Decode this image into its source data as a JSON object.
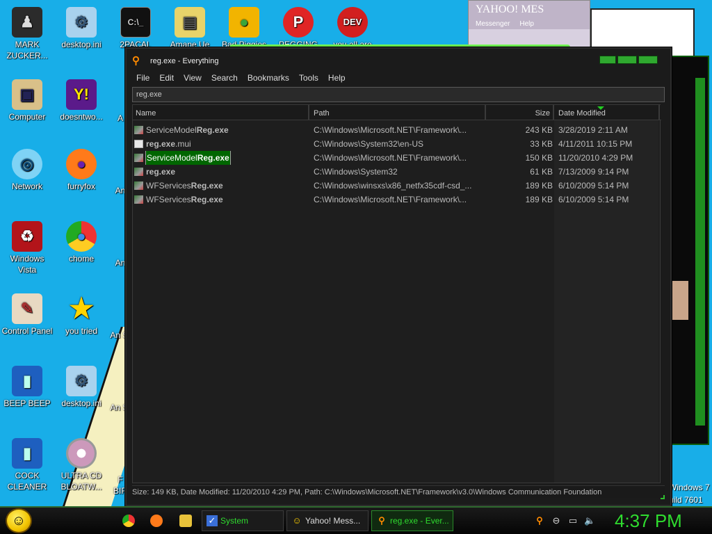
{
  "window": {
    "title": "reg.exe - Everything",
    "menu": [
      "File",
      "Edit",
      "View",
      "Search",
      "Bookmarks",
      "Tools",
      "Help"
    ],
    "search_value": "reg.exe",
    "columns": {
      "name": "Name",
      "path": "Path",
      "size": "Size",
      "date": "Date Modified"
    },
    "files": [
      {
        "pre": "ServiceModel",
        "bold": "Reg.exe",
        "post": "",
        "path": "C:\\Windows\\Microsoft.NET\\Framework\\...",
        "size": "243 KB",
        "date": "3/28/2019 2:11 AM",
        "icon": "reg-icon"
      },
      {
        "pre": "",
        "bold": "reg.exe",
        "post": ".mui",
        "path": "C:\\Windows\\System32\\en-US",
        "size": "33 KB",
        "date": "4/11/2011 10:15 PM",
        "icon": "mui-file-icon"
      },
      {
        "pre": "ServiceModel",
        "bold": "Reg.exe",
        "post": "",
        "path": "C:\\Windows\\Microsoft.NET\\Framework\\...",
        "size": "150 KB",
        "date": "11/20/2010 4:29 PM",
        "icon": "reg-icon",
        "selected": true
      },
      {
        "pre": "",
        "bold": "reg.exe",
        "post": "",
        "path": "C:\\Windows\\System32",
        "size": "61 KB",
        "date": "7/13/2009 9:14 PM",
        "icon": "reg-icon"
      },
      {
        "pre": "WFServices",
        "bold": "Reg.exe",
        "post": "",
        "path": "C:\\Windows\\winsxs\\x86_netfx35cdf-csd_...",
        "size": "189 KB",
        "date": "6/10/2009 5:14 PM",
        "icon": "reg-icon"
      },
      {
        "pre": "WFServices",
        "bold": "Reg.exe",
        "post": "",
        "path": "C:\\Windows\\Microsoft.NET\\Framework\\...",
        "size": "189 KB",
        "date": "6/10/2009 5:14 PM",
        "icon": "reg-icon"
      }
    ],
    "status": "Size: 149 KB, Date Modified: 11/20/2010 4:29 PM, Path: C:\\Windows\\Microsoft.NET\\Framework\\v3.0\\Windows Communication Foundation"
  },
  "desktop": {
    "icons": [
      {
        "label": "MARK ZUCKER...",
        "icon": "person-icon"
      },
      {
        "label": "desktop.ini",
        "icon": "settings-file-icon"
      },
      {
        "label": "2PACAL",
        "icon": "cmd-icon"
      },
      {
        "label": "Amane Ue",
        "icon": "folder-icon"
      },
      {
        "label": "Bad Piggies",
        "icon": "piggy-icon"
      },
      {
        "label": "PEGGING",
        "icon": "p-app-icon"
      },
      {
        "label": "you all are",
        "icon": "devcpp-icon"
      },
      {
        "label": "Computer",
        "icon": "computer-icon"
      },
      {
        "label": "doesntwo...",
        "icon": "yahoo-icon"
      },
      {
        "label": "Network",
        "icon": "network-icon"
      },
      {
        "label": "furryfox",
        "icon": "firefox-icon"
      },
      {
        "label": "Windows Vista",
        "icon": "recycle-bin-icon"
      },
      {
        "label": "chome",
        "icon": "chrome-icon"
      },
      {
        "label": "Control Panel",
        "icon": "control-panel-icon"
      },
      {
        "label": "you tried",
        "icon": "star-icon"
      },
      {
        "label": "BEEP BEEP",
        "icon": "blue-app-icon"
      },
      {
        "label": "desktop.ini",
        "icon": "settings-file-icon"
      },
      {
        "label": "COCK CLEANER",
        "icon": "blue-app-icon"
      },
      {
        "label": "ULTRA CD BLOATW...",
        "icon": "cd-icon"
      }
    ],
    "partial_labels": [
      "A",
      "An",
      "An S",
      "An",
      "An St",
      "An St",
      "F BIR"
    ],
    "yahoo_window": {
      "title": "YAHOO! MES",
      "sub": "Messenger",
      "help": "Help"
    },
    "os_text": [
      "Windows 7",
      "uild 7601"
    ]
  },
  "taskbar": {
    "tasks": [
      {
        "label": "System",
        "icon": "system-icon"
      },
      {
        "label": "Yahoo! Mess...",
        "icon": "yahoo-icon"
      },
      {
        "label": "reg.exe - Ever...",
        "icon": "everything-icon"
      }
    ],
    "clock": "4:37 PM"
  },
  "colors": {
    "accent": "#2fdc2f",
    "desktop": "#18aee8",
    "window_bg": "#1b1b1b"
  }
}
